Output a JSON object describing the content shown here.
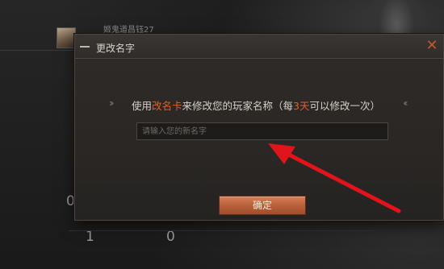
{
  "background": {
    "player_name": "姬鬼道昌钰27",
    "stats": [
      "1",
      "0"
    ],
    "side_number": "0"
  },
  "dialog": {
    "title": "更改名字",
    "close_glyph": "✕",
    "notice_prefix": "使用",
    "notice_card": "改名卡",
    "notice_mid": "来修改您的玩家名称（每",
    "notice_days": "3天",
    "notice_suffix": "可以修改一次）",
    "chevron_left": "››",
    "chevron_right": "‹‹",
    "input_placeholder": "请输入您的新名字",
    "input_value": "",
    "confirm_label": "确定"
  },
  "colors": {
    "accent": "#e0602e",
    "button": "#b9603a",
    "annotation_arrow": "#e0141a"
  },
  "annotation": {
    "type": "arrow",
    "points_to": "name-input"
  }
}
